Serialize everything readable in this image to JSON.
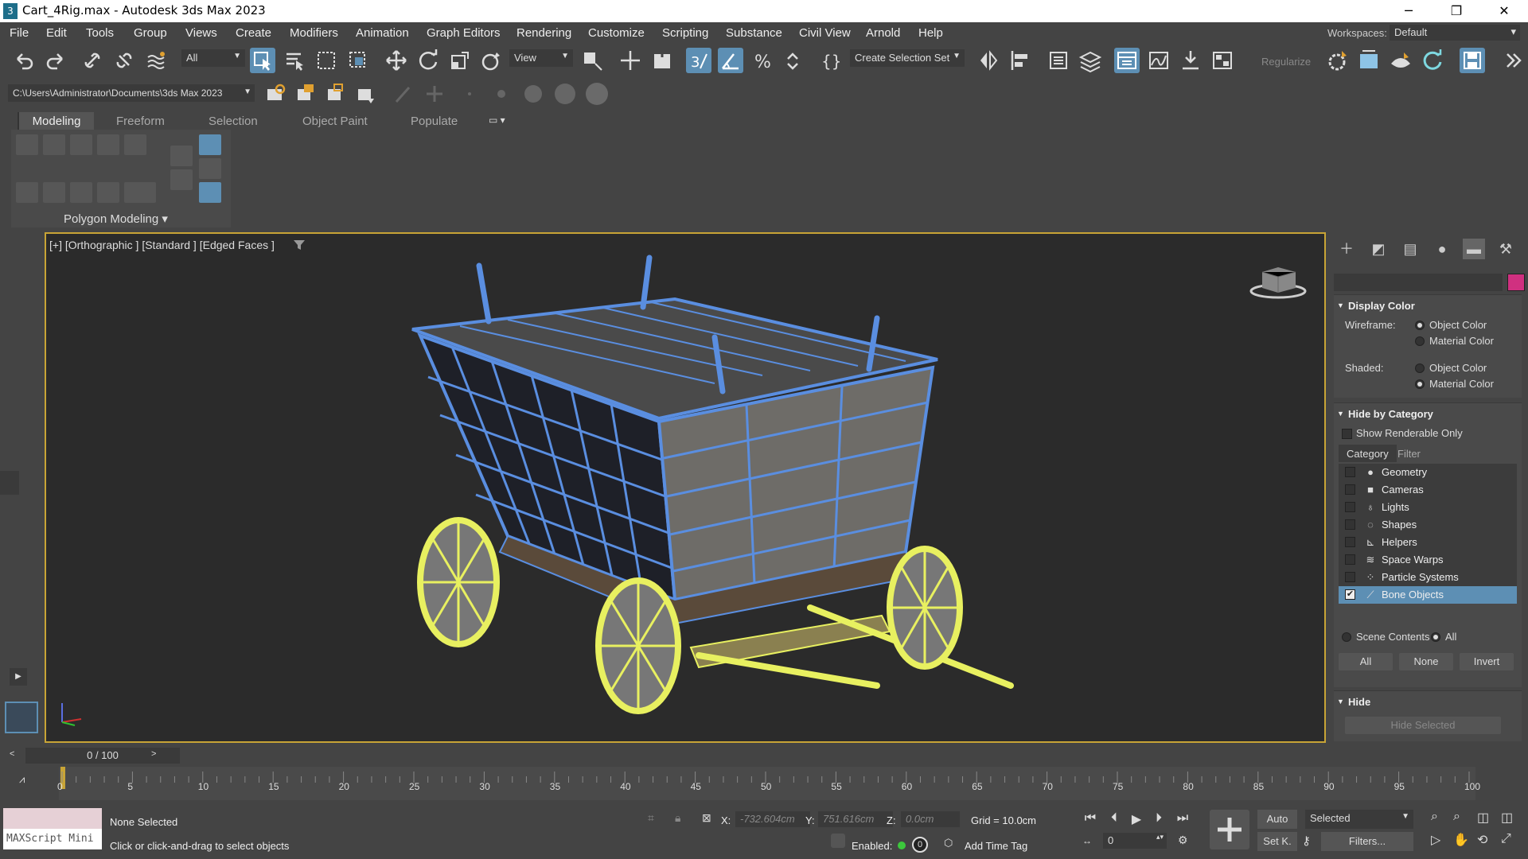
{
  "window": {
    "title": "Cart_4Rig.max - Autodesk 3ds Max 2023",
    "app_icon_glyph": "3",
    "minimize": "─",
    "maximize": "❐",
    "close": "✕"
  },
  "menu": [
    "File",
    "Edit",
    "Tools",
    "Group",
    "Views",
    "Create",
    "Modifiers",
    "Animation",
    "Graph Editors",
    "Rendering",
    "Customize",
    "Scripting",
    "Substance",
    "Civil View",
    "Arnold",
    "Help"
  ],
  "workspaces": {
    "label": "Workspaces:",
    "value": "Default"
  },
  "toolbar": {
    "filter_value": "All",
    "ref_coord_value": "View",
    "selection_set_placeholder": "Create Selection Set",
    "regularize": "Regularize",
    "project_path": "C:\\Users\\Administrator\\Documents\\3ds Max 2023"
  },
  "ribbon": {
    "tabs": [
      "Modeling",
      "Freeform",
      "Selection",
      "Object Paint",
      "Populate"
    ],
    "active_tab": "Modeling",
    "panel_label": "Polygon Modeling"
  },
  "viewport": {
    "label": "[+] [Orthographic ] [Standard ] [Edged Faces ]",
    "border_color": "#c8a436",
    "wire_blue": "#5a8ee0",
    "wire_yellow": "#e8f060"
  },
  "command_panel": {
    "swatch_color": "#d03080",
    "display_color": {
      "title": "Display Color",
      "wireframe_label": "Wireframe:",
      "shaded_label": "Shaded:",
      "wireframe_options": [
        "Object Color",
        "Material Color"
      ],
      "wireframe_selected": 0,
      "shaded_options": [
        "Object Color",
        "Material Color"
      ],
      "shaded_selected": 1
    },
    "hide_by_category": {
      "title": "Hide by Category",
      "renderable_only": "Show Renderable Only",
      "tabs": [
        "Category",
        "Filter"
      ],
      "items": [
        {
          "label": "Geometry",
          "icon": "sphere-icon",
          "checked": false
        },
        {
          "label": "Cameras",
          "icon": "camera-icon",
          "checked": false
        },
        {
          "label": "Lights",
          "icon": "light-icon",
          "checked": false
        },
        {
          "label": "Shapes",
          "icon": "shape-icon",
          "checked": false
        },
        {
          "label": "Helpers",
          "icon": "helper-icon",
          "checked": false
        },
        {
          "label": "Space Warps",
          "icon": "spacewarp-icon",
          "checked": false
        },
        {
          "label": "Particle Systems",
          "icon": "particle-icon",
          "checked": false
        },
        {
          "label": "Bone Objects",
          "icon": "bone-icon",
          "checked": true
        }
      ],
      "scene_contents": "Scene Contents",
      "all_radio": "All",
      "buttons": [
        "All",
        "None",
        "Invert"
      ]
    },
    "hide": {
      "title": "Hide",
      "hide_selected": "Hide Selected"
    }
  },
  "timeline": {
    "frame_display": "0 / 100",
    "ticks": [
      "0",
      "5",
      "10",
      "15",
      "20",
      "25",
      "30",
      "35",
      "40",
      "45",
      "50",
      "55",
      "60",
      "65",
      "70",
      "75",
      "80",
      "85",
      "90",
      "95",
      "100"
    ]
  },
  "status": {
    "maxscript": "MAXScript Mini",
    "selection": "None Selected",
    "prompt": "Click or click-and-drag to select objects",
    "x_label": "X:",
    "x_value": "-732.604cm",
    "y_label": "Y:",
    "y_value": "751.616cm",
    "z_label": "Z:",
    "z_value": "0.0cm",
    "grid": "Grid = 10.0cm",
    "enabled_label": "Enabled:",
    "enabled_value": "0",
    "add_time_tag": "Add Time Tag",
    "auto_key": "Auto",
    "set_key": "Set K.",
    "key_filter_value": "Selected",
    "filters": "Filters...",
    "current_frame": "0"
  }
}
